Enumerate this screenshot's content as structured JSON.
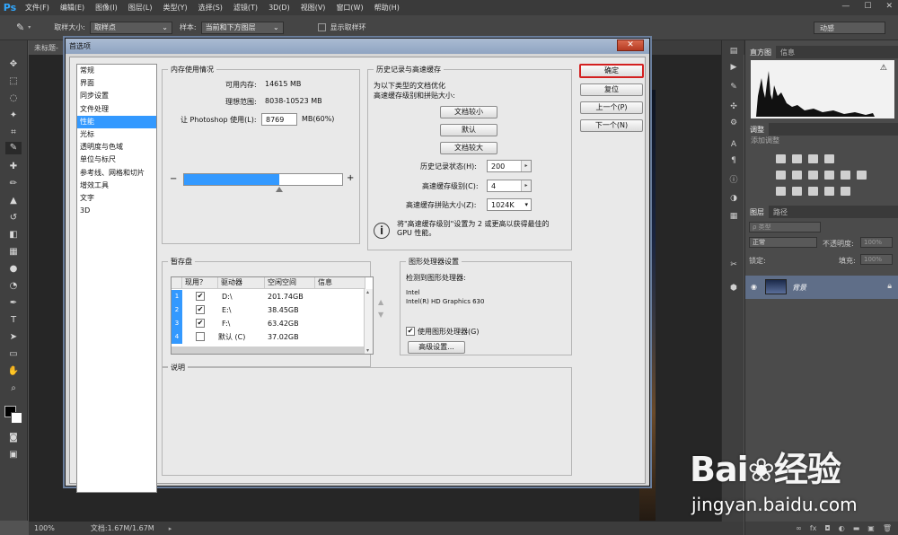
{
  "app": {
    "logo": "Ps",
    "menu": [
      "文件(F)",
      "编辑(E)",
      "图像(I)",
      "图层(L)",
      "类型(Y)",
      "选择(S)",
      "滤镜(T)",
      "3D(D)",
      "视图(V)",
      "窗口(W)",
      "帮助(H)"
    ],
    "window_controls": [
      "—",
      "☐",
      "✕"
    ]
  },
  "options_bar": {
    "sample_size_label": "取样大小:",
    "sample_size_value": "取样点",
    "sample_label": "样本:",
    "sample_value": "当前和下方图层",
    "show_ring_label": "显示取样环",
    "workspace": "动感"
  },
  "document": {
    "tab_label": "未标题-",
    "zoom": "100%",
    "doc_info": "文档:1.67M/1.67M"
  },
  "right_panels": {
    "top_tabs": [
      "直方图",
      "信息"
    ],
    "adjustments_tab": "调整",
    "adjustments_label": "添加调整",
    "layers_tabs": [
      "图层",
      "路径"
    ],
    "filter_label": "ρ 类型",
    "blend_mode": "正常",
    "opacity_label": "不透明度:",
    "opacity_value": "100%",
    "lock_label": "锁定:",
    "fill_label": "填充:",
    "fill_value": "100%",
    "layer_name": "背景",
    "bottom_icons": [
      "∞",
      "fx",
      "◘",
      "◐",
      "▬",
      "▣",
      "🗑"
    ]
  },
  "dialog": {
    "title": "首选项",
    "close": "✕",
    "categories": [
      "常规",
      "界面",
      "同步设置",
      "文件处理",
      "性能",
      "光标",
      "透明度与色域",
      "单位与标尺",
      "参考线、网格和切片",
      "增效工具",
      "文字",
      "3D"
    ],
    "selected_category": 4,
    "memory": {
      "title": "内存使用情况",
      "available_label": "可用内存:",
      "available_value": "14615 MB",
      "ideal_label": "理想范围:",
      "ideal_value": "8038-10523 MB",
      "let_label": "让 Photoshop 使用(L):",
      "let_value": "8769",
      "let_unit": "MB(60%)",
      "usage_fraction": 0.6,
      "minus": "−",
      "plus": "+"
    },
    "history": {
      "title": "历史记录与高速缓存",
      "desc_line1": "为以下类型的文档优化",
      "desc_line2": "高速缓存级别和拼贴大小:",
      "btn_tall": "文档较小",
      "btn_default": "默认",
      "btn_large": "文档较大",
      "states_label": "历史记录状态(H):",
      "states_value": "200",
      "levels_label": "高速缓存级别(C):",
      "levels_value": "4",
      "tile_label": "高速缓存拼贴大小(Z):",
      "tile_value": "1024K",
      "note_line1": "将\"高速缓存级别\"设置为 2 或更高以获得最佳的",
      "note_line2": "GPU 性能。"
    },
    "scratch": {
      "title": "暂存盘",
      "headers": [
        "现用？",
        "驱动器",
        "空闲空间",
        "信息"
      ],
      "rows": [
        {
          "num": "1",
          "checked": "✔",
          "drive": "D:\\",
          "free": "201.74GB"
        },
        {
          "num": "2",
          "checked": "✔",
          "drive": "E:\\",
          "free": "38.45GB"
        },
        {
          "num": "3",
          "checked": "✔",
          "drive": "F:\\",
          "free": "63.42GB"
        },
        {
          "num": "4",
          "checked": "",
          "drive": "默认 (C)",
          "free": "37.02GB"
        }
      ],
      "arrow_up": "▲",
      "arrow_down": "▼"
    },
    "gpu": {
      "title": "图形处理器设置",
      "detected_label": "检测到图形处理器:",
      "vendor": "Intel",
      "model": "Intel(R) HD Graphics 630",
      "use_label": "使用图形处理器(G)",
      "use_checked": "✔",
      "advanced_button": "高级设置..."
    },
    "description": {
      "title": "说明"
    },
    "buttons": {
      "ok": "确定",
      "reset": "复位",
      "prev": "上一个(P)",
      "next": "下一个(N)"
    }
  },
  "watermark": {
    "brand": "Bai",
    "brand_suffix": "经验",
    "url": "jingyan.baidu.com"
  },
  "colors": {
    "accent": "#3399ff",
    "ok_highlight": "#d32020",
    "ps_dark": "#535353"
  }
}
